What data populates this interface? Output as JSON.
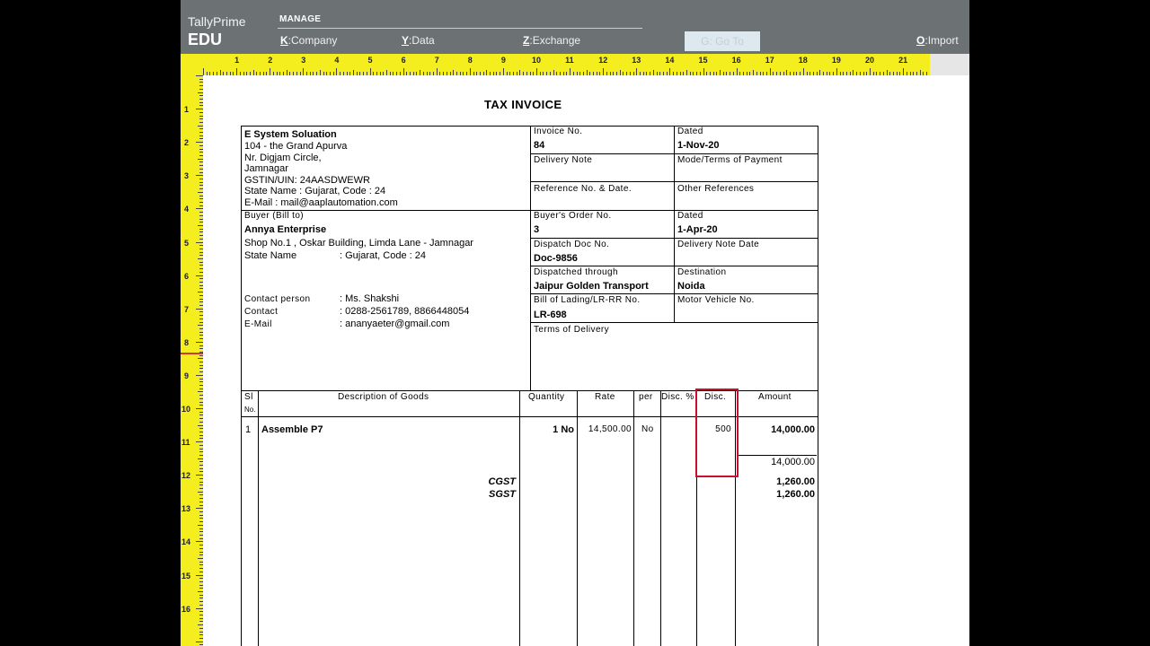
{
  "topbar": {
    "brand": "TallyPrime",
    "edition": "EDU",
    "manage_label": "MANAGE",
    "menu": [
      {
        "key": "K",
        "label": "Company"
      },
      {
        "key": "Y",
        "label": "Data"
      },
      {
        "key": "Z",
        "label": "Exchange"
      },
      {
        "key": "O",
        "label": "Import"
      }
    ],
    "goto_label": "G: Go To"
  },
  "ruler": {
    "h_numbers": [
      "1",
      "2",
      "3",
      "4",
      "5",
      "6",
      "7",
      "8",
      "9",
      "10",
      "11",
      "12",
      "13",
      "14",
      "15",
      "16",
      "17",
      "18",
      "19",
      "20",
      "21"
    ],
    "v_numbers": [
      "1",
      "2",
      "3",
      "4",
      "5",
      "6",
      "7",
      "8",
      "9",
      "10",
      "11",
      "12",
      "13",
      "14",
      "15",
      "16"
    ]
  },
  "invoice": {
    "title": "TAX INVOICE",
    "seller": {
      "name": "E System Soluation",
      "addr1": "104 - the Grand Apurva",
      "addr2": "Nr. Digjam Circle,",
      "addr3": "Jamnagar",
      "gstin": "GSTIN/UIN: 24AASDWEWR",
      "state": "State Name :  Gujarat, Code : 24",
      "email": "E-Mail : mail@aaplautomation.com"
    },
    "meta": {
      "invoice_no_label": "Invoice No.",
      "invoice_no": "84",
      "dated_label": "Dated",
      "dated": "1-Nov-20",
      "delivery_note_label": "Delivery Note",
      "mode_terms_label": "Mode/Terms of Payment",
      "reference_label": "Reference No. & Date.",
      "other_ref_label": "Other References",
      "buyers_order_label": "Buyer's Order No.",
      "buyers_order": "3",
      "order_dated_label": "Dated",
      "order_dated": "1-Apr-20",
      "dispatch_doc_label": "Dispatch Doc No.",
      "dispatch_doc": "Doc-9856",
      "delivery_note_date_label": "Delivery Note Date",
      "dispatched_through_label": "Dispatched through",
      "dispatched_through": "Jaipur Golden Transport",
      "destination_label": "Destination",
      "destination": "Noida",
      "lading_label": "Bill of Lading/LR-RR No.",
      "lading": "LR-698",
      "vehicle_label": "Motor Vehicle No.",
      "terms_delivery_label": "Terms of Delivery"
    },
    "buyer": {
      "label": "Buyer (Bill to)",
      "name": "Annya Enterprise",
      "address": "Shop No.1 , Oskar Building, Limda Lane - Jamnagar",
      "state_label": "State Name",
      "state": ":  Gujarat, Code : 24",
      "contact_person_label": "Contact person",
      "contact_person": ":  Ms. Shakshi",
      "contact_label": "Contact",
      "contact": ":  0288-2561789, 8866448054",
      "email_label": "E-Mail",
      "email": ":  ananyaeter@gmail.com"
    },
    "columns": {
      "sl": "Sl",
      "no": "No.",
      "description": "Description of Goods",
      "quantity": "Quantity",
      "rate": "Rate",
      "per": "per",
      "disc_pct": "Disc. %",
      "disc": "Disc.",
      "amount": "Amount"
    },
    "items": [
      {
        "sl": "1",
        "description": "Assemble P7",
        "quantity": "1 No",
        "rate": "14,500.00",
        "per": "No",
        "disc": "500",
        "amount": "14,000.00"
      }
    ],
    "subtotal": "14,000.00",
    "taxes": [
      {
        "label": "CGST",
        "amount": "1,260.00"
      },
      {
        "label": "SGST",
        "amount": "1,260.00"
      }
    ]
  }
}
